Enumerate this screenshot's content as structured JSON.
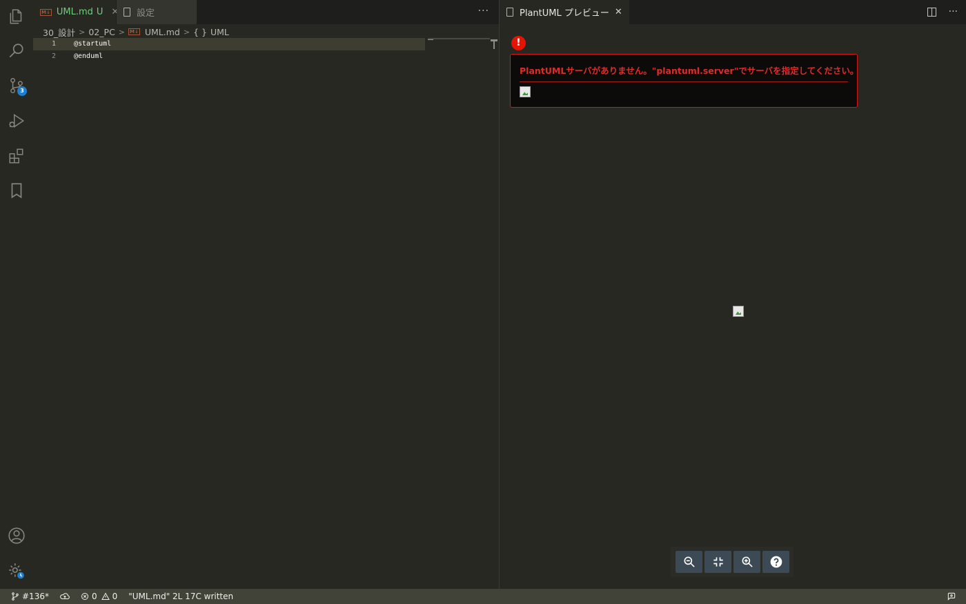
{
  "activity_bar": {
    "source_control_badge": "3"
  },
  "left_editor": {
    "tabs": [
      {
        "label": "UML.md",
        "status": "U",
        "icon": "markdown-icon",
        "active": true
      },
      {
        "label": "設定",
        "icon": "file-icon",
        "active": false
      }
    ],
    "more_actions": "···",
    "breadcrumb": [
      "30_設計",
      "02_PC",
      "UML.md",
      "UML"
    ],
    "breadcrumb_symbol": "{ }",
    "lines": [
      {
        "number": "1",
        "text": "@startuml"
      },
      {
        "number": "2",
        "text": "@enduml"
      }
    ]
  },
  "preview": {
    "tab_label": "PlantUML プレビュー",
    "more_actions": "···",
    "error_icon": "!",
    "error_message": "PlantUMLサーバがありません。\"plantuml.server\"でサーバを指定してください。",
    "zoom_buttons": [
      "zoom-out-icon",
      "fit-icon",
      "zoom-in-icon",
      "help-icon"
    ]
  },
  "status_bar": {
    "branch": "#136*",
    "errors": "0",
    "warnings": "0",
    "message": "\"UML.md\" 2L 17C written"
  },
  "colors": {
    "background": "#272822",
    "tabbar": "#1e1f1c",
    "statusbar": "#414339",
    "error": "#e12a2a",
    "tab_active_text": "#6fcf7a"
  }
}
